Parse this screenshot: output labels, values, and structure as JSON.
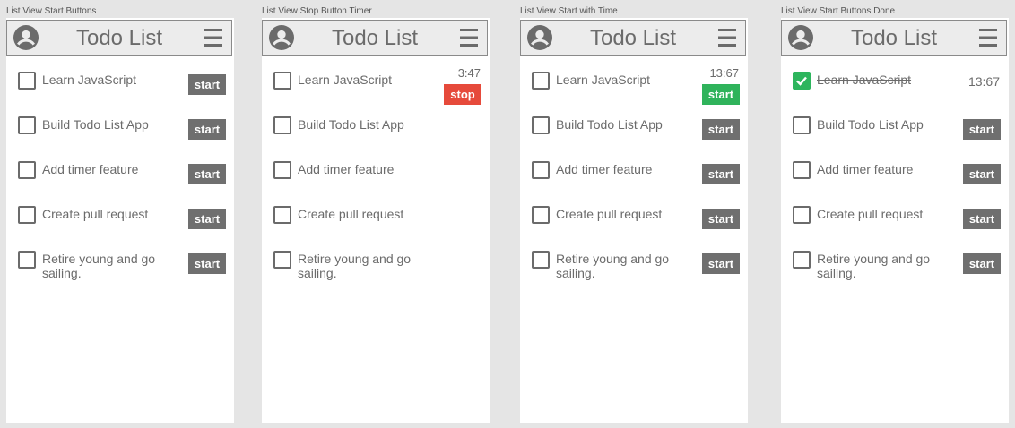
{
  "frames": [
    {
      "label": "List View Start Buttons",
      "title": "Todo List",
      "items": [
        {
          "text": "Learn JavaScript",
          "button": "start"
        },
        {
          "text": "Build Todo List App",
          "button": "start"
        },
        {
          "text": "Add timer feature",
          "button": "start"
        },
        {
          "text": "Create pull request",
          "button": "start"
        },
        {
          "text": "Retire young and go sailing.",
          "button": "start"
        }
      ]
    },
    {
      "label": "List View Stop Button Timer",
      "title": "Todo List",
      "items": [
        {
          "text": "Learn JavaScript",
          "timer": "3:47",
          "button": "stop"
        },
        {
          "text": "Build Todo List App"
        },
        {
          "text": "Add timer feature"
        },
        {
          "text": "Create pull request"
        },
        {
          "text": "Retire young and go sailing."
        }
      ]
    },
    {
      "label": "List View Start with Time",
      "title": "Todo List",
      "items": [
        {
          "text": "Learn JavaScript",
          "timer": "13:67",
          "button": "start"
        },
        {
          "text": "Build Todo List App",
          "button": "start"
        },
        {
          "text": "Add timer feature",
          "button": "start"
        },
        {
          "text": "Create pull request",
          "button": "start"
        },
        {
          "text": "Retire young and go sailing.",
          "button": "start"
        }
      ]
    },
    {
      "label": "List View Start Buttons Done",
      "title": "Todo List",
      "items": [
        {
          "text": "Learn JavaScript",
          "timer": "13:67",
          "done": true
        },
        {
          "text": "Build Todo List App",
          "button": "start"
        },
        {
          "text": "Add timer feature",
          "button": "start"
        },
        {
          "text": "Create pull request",
          "button": "start"
        },
        {
          "text": "Retire young and go sailing.",
          "button": "start"
        }
      ]
    }
  ],
  "colors": {
    "stop_button": "#e64a3b",
    "start_running_button": "#2fb35b",
    "start_button": "#6f6f6f",
    "checked_box": "#2db55d"
  },
  "icons": {
    "header_left": "account-circle-icon",
    "header_right": "hamburger-menu-icon",
    "done_mark": "checkmark-icon"
  }
}
